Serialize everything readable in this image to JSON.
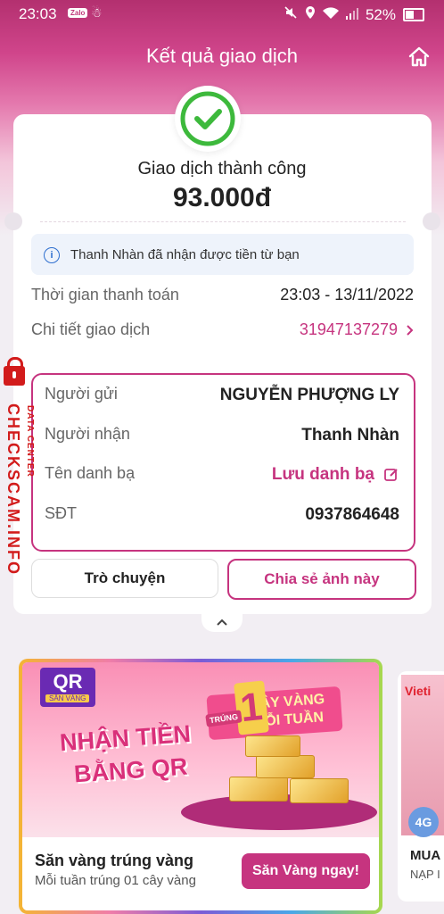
{
  "status_bar": {
    "time": "23:03",
    "app1": "Zalo",
    "app2": "☃",
    "battery": "52%"
  },
  "header": {
    "title": "Kết quả giao dịch"
  },
  "result": {
    "status": "Giao dịch thành công",
    "amount": "93.000đ"
  },
  "notice": {
    "text": "Thanh Nhàn đã nhận được tiền từ bạn"
  },
  "payment": {
    "time_label": "Thời gian thanh toán",
    "time_value": "23:03 - 13/11/2022",
    "detail_label": "Chi tiết giao dịch",
    "detail_value": "31947137279"
  },
  "parties": {
    "sender_label": "Người gửi",
    "sender_value": "NGUYỄN PHƯỢNG LY",
    "receiver_label": "Người nhận",
    "receiver_value": "Thanh Nhàn",
    "contact_label": "Tên danh bạ",
    "contact_value": "Lưu danh bạ",
    "phone_label": "SĐT",
    "phone_value": "0937864648"
  },
  "actions": {
    "chat": "Trò chuyện",
    "share": "Chia sẻ ảnh này"
  },
  "promo": {
    "logo": "QR",
    "logo_sub": "SĂN VÀNG",
    "trung": "TRÚNG",
    "one": "1",
    "headline1": "CÂY VÀNG",
    "headline2": "MỖI TUẦN",
    "line1": "NHẬN TIỀN",
    "line2": "BẰNG QR",
    "title": "Săn vàng trúng vàng",
    "subtitle": "Mỗi tuần trúng 01 cây vàng",
    "cta": "Săn Vàng ngay!"
  },
  "promo2": {
    "brand": "Vieti",
    "badge": "4G",
    "title": "MUA",
    "subtitle": "NẠP I"
  },
  "watermark": {
    "site": "CHECKSCAM.INFO",
    "label": "DATA CENTER"
  },
  "colors": {
    "accent": "#c6347f",
    "success": "#3db93c",
    "info": "#2e6fcf"
  }
}
